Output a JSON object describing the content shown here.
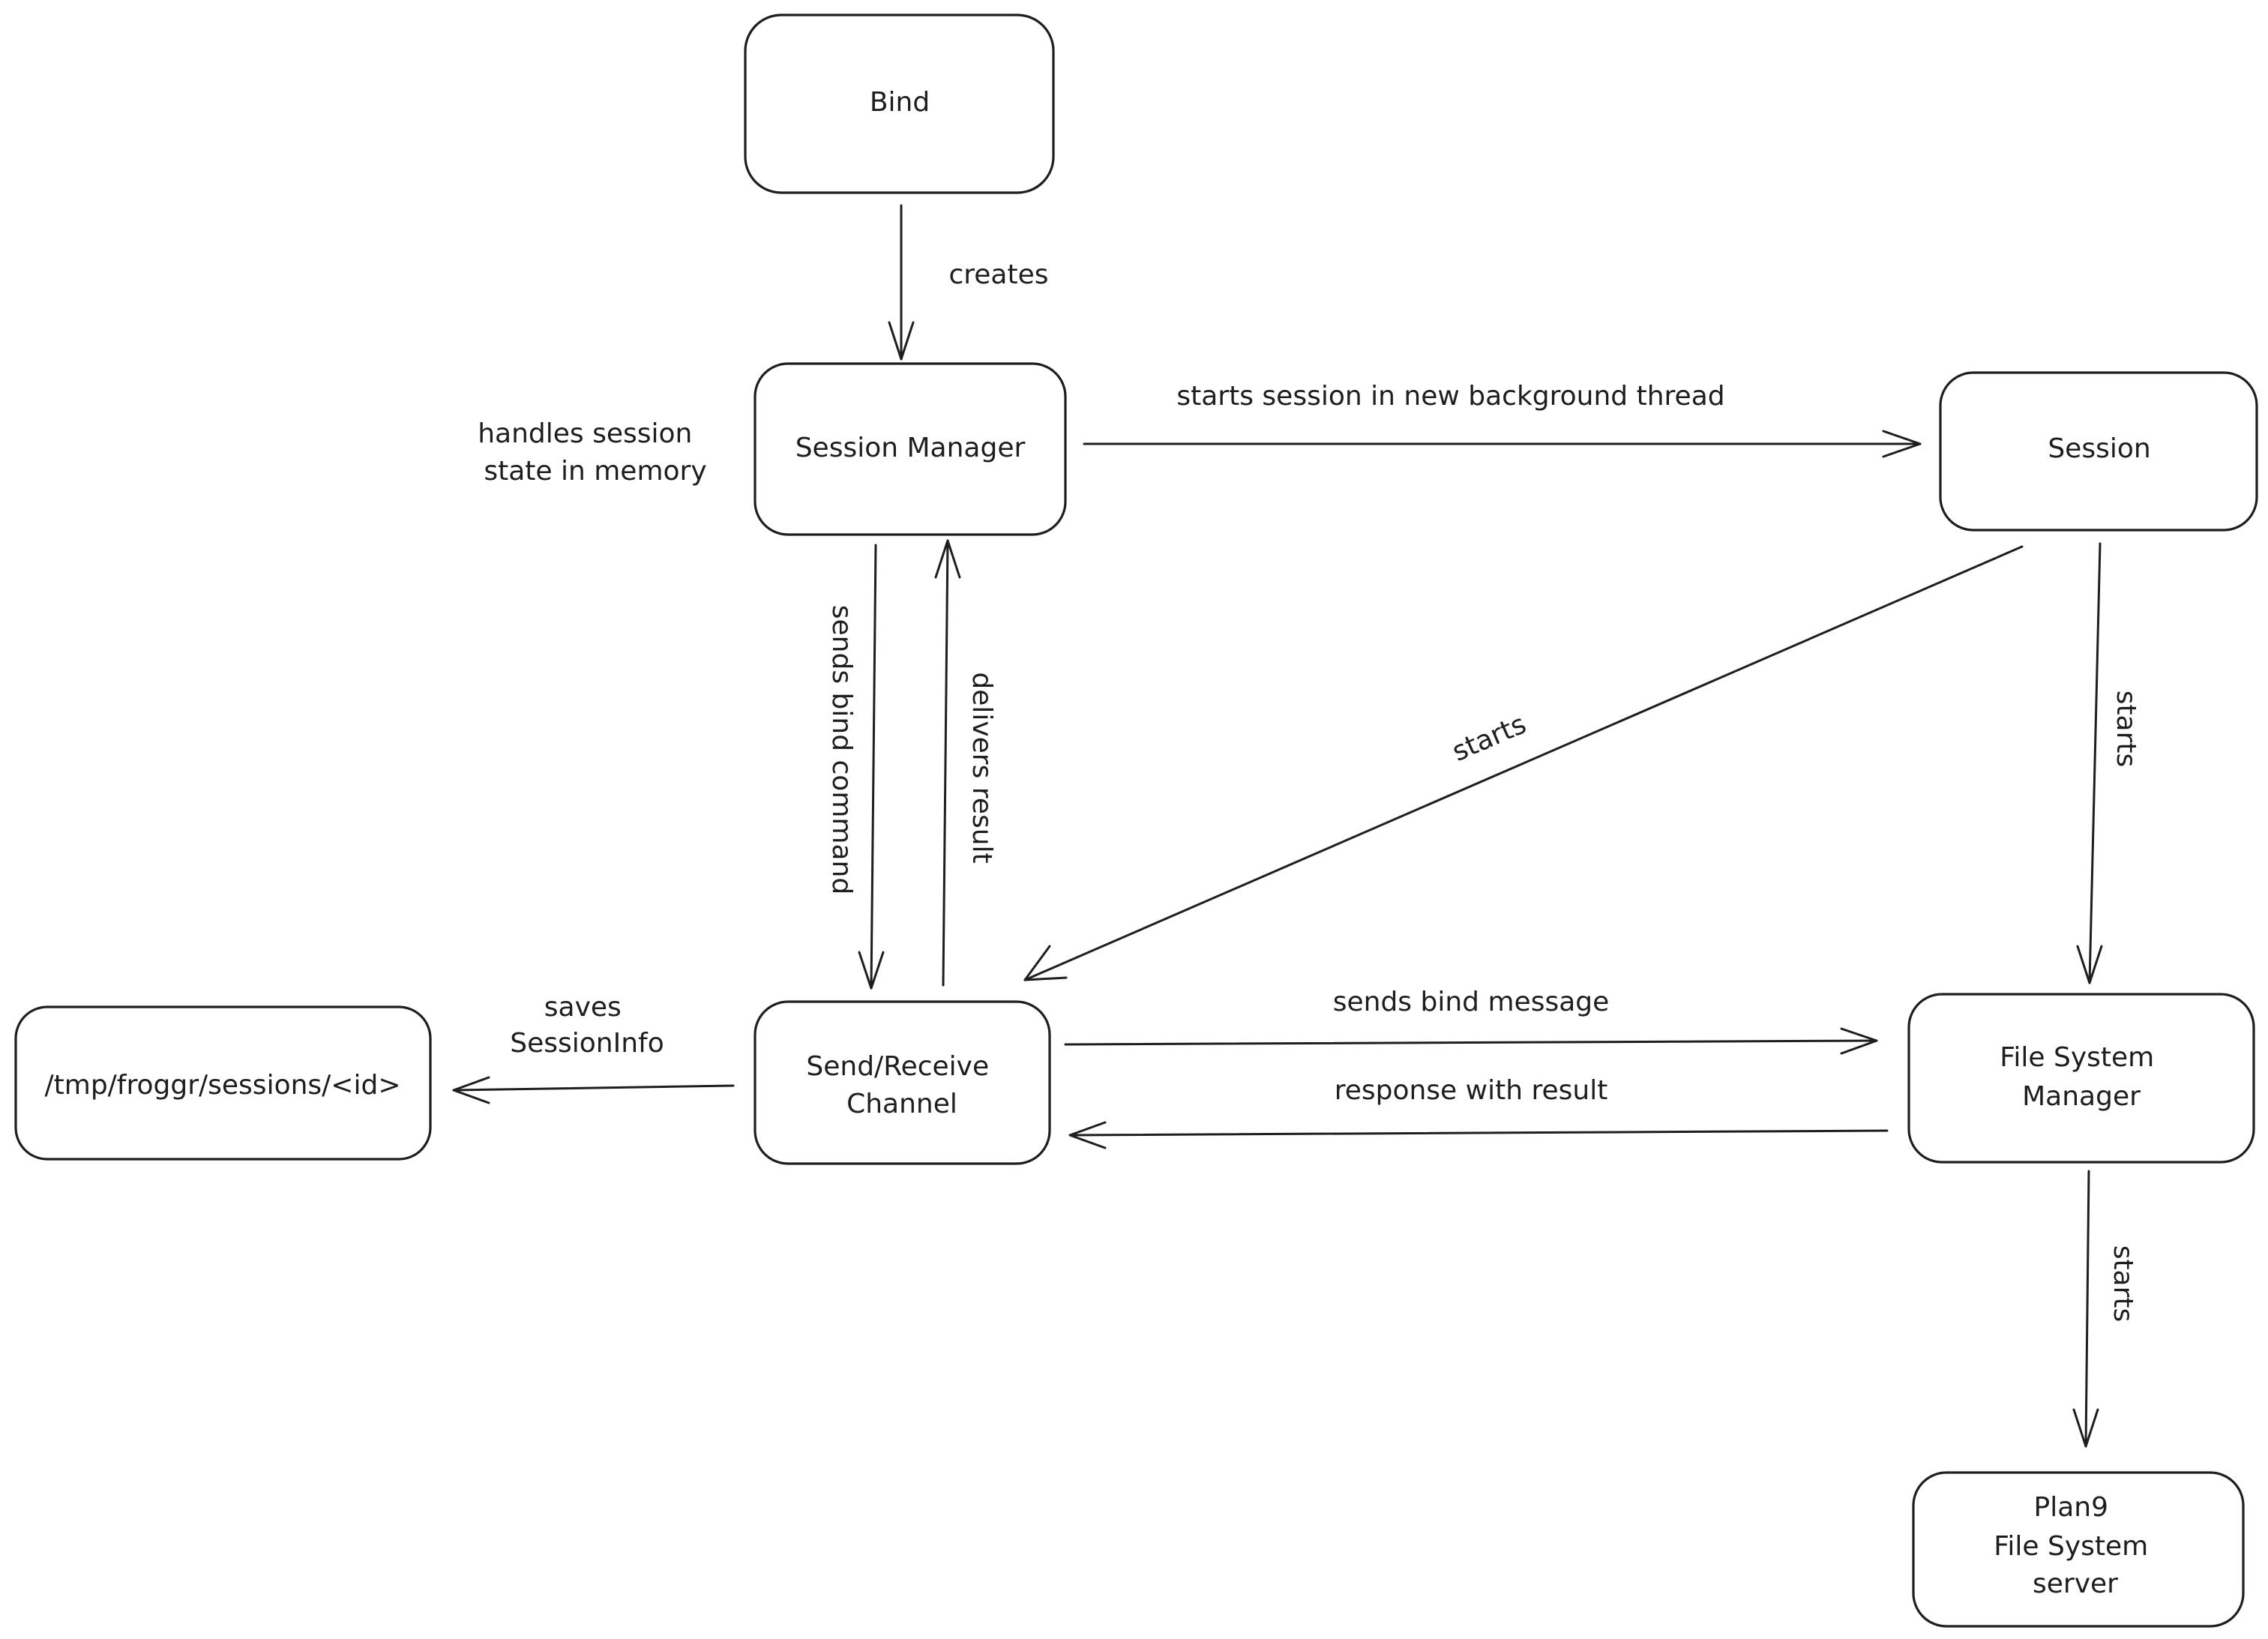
{
  "diagram": {
    "stroke_color": "#1e1e1e",
    "background": "#ffffff",
    "nodes": {
      "bind": {
        "lines": [
          "Bind"
        ]
      },
      "session_manager": {
        "lines": [
          "Session Manager"
        ]
      },
      "session": {
        "lines": [
          "Session"
        ]
      },
      "send_receive_channel": {
        "lines": [
          "Send/Receive",
          "Channel"
        ]
      },
      "file_system_manager": {
        "lines": [
          "File System",
          "Manager"
        ]
      },
      "plan9_server": {
        "lines": [
          "Plan9",
          "File System",
          "server"
        ]
      },
      "tmp_sessions": {
        "lines": [
          "/tmp/froggr/sessions/<id>"
        ]
      }
    },
    "edges": {
      "bind_to_session_manager": {
        "from": "Bind",
        "to": "Session Manager",
        "label": [
          "creates"
        ]
      },
      "session_manager_to_session": {
        "from": "Session Manager",
        "to": "Session",
        "label": [
          "starts session in new background thread"
        ]
      },
      "session_manager_to_channel": {
        "from": "Session Manager",
        "to": "Send/Receive Channel",
        "label": [
          "sends bind command"
        ]
      },
      "channel_to_session_manager": {
        "from": "Send/Receive Channel",
        "to": "Session Manager",
        "label": [
          "delivers result"
        ]
      },
      "session_to_channel": {
        "from": "Session",
        "to": "Send/Receive Channel",
        "label": [
          "starts"
        ]
      },
      "session_to_fsm": {
        "from": "Session",
        "to": "File System Manager",
        "label": [
          "starts"
        ]
      },
      "channel_to_fsm": {
        "from": "Send/Receive Channel",
        "to": "File System Manager",
        "label": [
          "sends bind message"
        ]
      },
      "fsm_to_channel": {
        "from": "File System Manager",
        "to": "Send/Receive Channel",
        "label": [
          "response with result"
        ]
      },
      "channel_to_tmp": {
        "from": "Send/Receive Channel",
        "to": "/tmp/froggr/sessions/<id>",
        "label": [
          "saves",
          "SessionInfo"
        ]
      },
      "fsm_to_plan9": {
        "from": "File System Manager",
        "to": "Plan9 File System server",
        "label": [
          "starts"
        ]
      }
    },
    "annotations": {
      "session_manager_note": {
        "lines": [
          "handles session",
          "state in memory"
        ]
      }
    }
  }
}
